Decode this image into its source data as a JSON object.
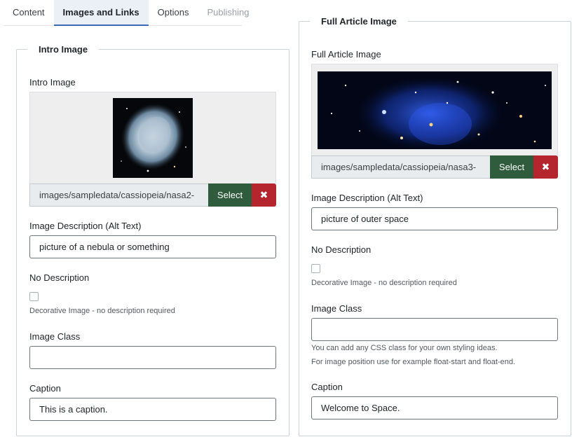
{
  "tabs": [
    {
      "label": "Content"
    },
    {
      "label": "Images and Links"
    },
    {
      "label": "Options"
    },
    {
      "label": "Publishing"
    }
  ],
  "intro": {
    "legend": "Intro Image",
    "image_label": "Intro Image",
    "image_path": "images/sampledata/cassiopeia/nasa2-",
    "select_label": "Select",
    "clear_symbol": "✖",
    "alt_label": "Image Description (Alt Text)",
    "alt_value": "picture of a nebula or something",
    "no_desc_label": "No Description",
    "decorative_label": "Decorative Image - no description required",
    "class_label": "Image Class",
    "class_value": "",
    "caption_label": "Caption",
    "caption_value": "This is a caption."
  },
  "full": {
    "legend": "Full Article Image",
    "image_label": "Full Article Image",
    "image_path": "images/sampledata/cassiopeia/nasa3-",
    "select_label": "Select",
    "clear_symbol": "✖",
    "alt_label": "Image Description (Alt Text)",
    "alt_value": "picture of outer space",
    "no_desc_label": "No Description",
    "decorative_label": "Decorative Image - no description required",
    "class_label": "Image Class",
    "class_value": "",
    "class_help_1": "You can add any CSS class for your own styling ideas.",
    "class_help_2": "For image position use for example float-start and float-end.",
    "caption_label": "Caption",
    "caption_value": "Welcome to Space."
  }
}
